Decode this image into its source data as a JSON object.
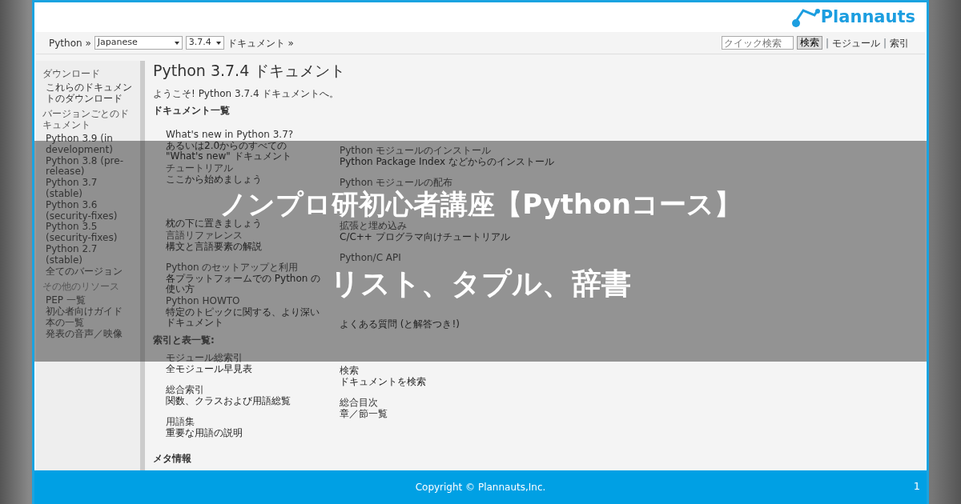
{
  "slide": {
    "logo": "Plannauts",
    "copyright": "Copyright © Plannauts,Inc.",
    "page_number": "1"
  },
  "docs": {
    "nav": {
      "breadcrumb_root": "Python »",
      "language": "Japanese",
      "version": "3.7.4",
      "breadcrumb_page": "ドキュメント »",
      "search": {
        "placeholder": "クイック検索",
        "button": "検索"
      },
      "separator": "|",
      "links": [
        "モジュール",
        "索引"
      ]
    },
    "sidebar": [
      {
        "heading": "ダウンロード",
        "items": [
          "これらのドキュメントのダウンロード"
        ]
      },
      {
        "heading": "バージョンごとのドキュメント",
        "items": [
          "Python 3.9 (in development)",
          "Python 3.8 (pre-release)",
          "Python 3.7 (stable)",
          "Python 3.6 (security-fixes)",
          "Python 3.5 (security-fixes)",
          "Python 2.7 (stable)",
          "全てのバージョン"
        ]
      },
      {
        "heading": "その他のリソース",
        "items": [
          "PEP 一覧",
          "初心者向けガイド",
          "本の一覧",
          "発表の音声／映像"
        ]
      }
    ],
    "title": "Python 3.7.4 ドキュメント",
    "welcome": "ようこそ! Python 3.7.4 ドキュメントへ。",
    "sections": [
      {
        "heading": "ドキュメント一覧",
        "columns": [
          [
            {
              "title": "What's new in Python 3.7?",
              "desc": "あるいは2.0からのすべての \"What's new\" ドキュメント"
            },
            {
              "title": "チュートリアル",
              "desc": "ここから始めましょう"
            },
            {
              "desc": "枕の下に置きましょう"
            },
            {
              "title": "言語リファレンス",
              "desc": "構文と言語要素の解説"
            },
            {
              "title": "Python のセットアップと利用",
              "desc": "各プラットフォームでの Python の使い方"
            },
            {
              "title": "Python HOWTO",
              "desc": "特定のトピックに関する、より深いドキュメント"
            }
          ],
          [
            {
              "title": "Python モジュールのインストール",
              "desc": "Python Package Index などからのインストール"
            },
            {
              "title": "Python モジュールの配布"
            },
            {
              "title": "拡張と埋め込み",
              "desc": "C/C++ プログラマ向けチュートリアル"
            },
            {
              "title": "Python/C API"
            },
            {
              "desc": "よくある質問 (と解答つき!)"
            }
          ]
        ]
      },
      {
        "heading": "索引と表一覧:",
        "columns": [
          [
            {
              "title": "モジュール総索引",
              "desc": "全モジュール早見表"
            },
            {
              "title": "総合索引",
              "desc": "関数、クラスおよび用語総覧"
            },
            {
              "title": "用語集",
              "desc": "重要な用語の説明"
            }
          ],
          [
            {
              "title": "検索",
              "desc": "ドキュメントを検索"
            },
            {
              "title": "総合目次",
              "desc": "章／節一覧"
            }
          ]
        ]
      }
    ],
    "meta_heading": "メタ情報"
  },
  "banner": {
    "title": "ノンプロ研初心者講座【Pythonコース】",
    "subtitle": "リスト、タプル、辞書"
  }
}
